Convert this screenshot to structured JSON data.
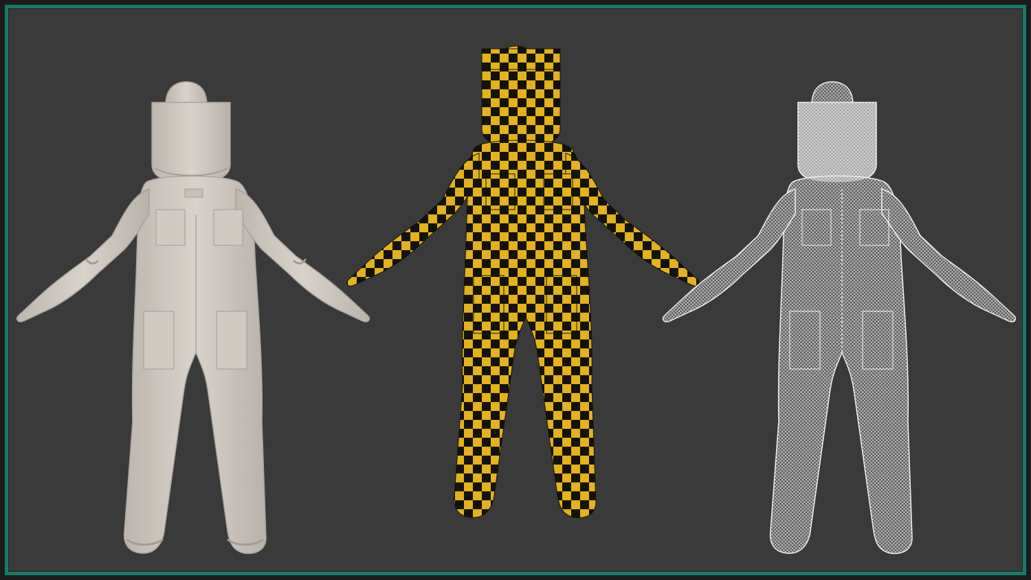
{
  "colors": {
    "background": "#3a3a3a",
    "frame_border": "#157b6b",
    "clay_suit": "#d3cdc6",
    "checker_yellow": "#e3b21c",
    "checker_black": "#141209",
    "wireframe": "#ececec"
  },
  "figures": [
    {
      "id": "clay",
      "shading": "clay"
    },
    {
      "id": "checker",
      "shading": "uv-checker"
    },
    {
      "id": "wire",
      "shading": "wireframe"
    }
  ]
}
